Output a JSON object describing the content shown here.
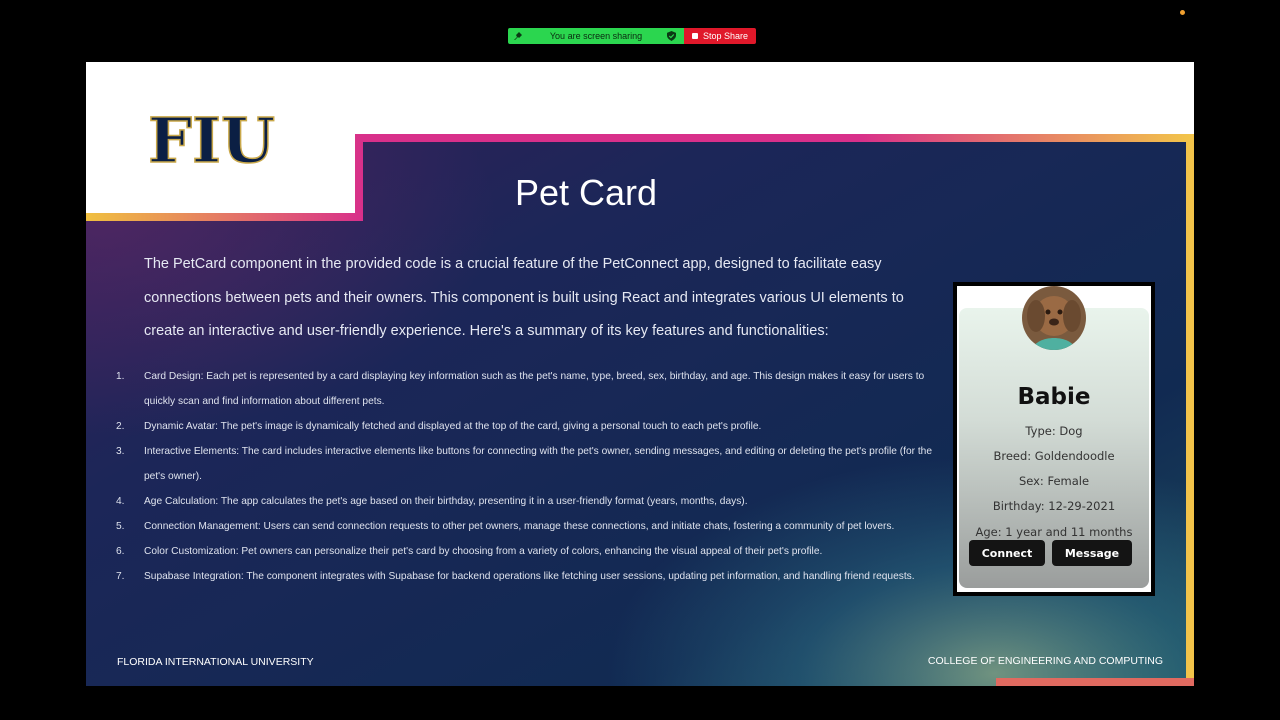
{
  "share_bar": {
    "status_text": "You are screen sharing",
    "stop_label": "Stop Share",
    "status_color": "#2bd64f",
    "stop_color": "#e0182a"
  },
  "slide": {
    "logo_text": "FIU",
    "title": "Pet Card",
    "intro": "The PetCard component in the provided code is a crucial feature of the PetConnect app, designed to facilitate easy connections between pets and their owners. This component is built using React and integrates various UI elements to create an interactive and user-friendly experience. Here's a summary of its key features and functionalities:",
    "features": [
      {
        "num": "1.",
        "text": "Card Design: Each pet is represented by a card displaying key information such as the pet's name, type, breed, sex, birthday, and age. This design makes it easy for users to quickly scan and find information about different pets."
      },
      {
        "num": "2.",
        "text": "Dynamic Avatar: The pet's image is dynamically fetched and displayed at the top of the card, giving a personal touch to each pet's profile."
      },
      {
        "num": "3.",
        "text": "Interactive Elements: The card includes interactive elements like buttons for connecting with the pet's owner, sending messages, and editing or deleting the pet's profile (for the pet's owner)."
      },
      {
        "num": "4.",
        "text": "Age Calculation: The app calculates the pet's age based on their birthday, presenting it in a user-friendly format (years, months, days)."
      },
      {
        "num": "5.",
        "text": "Connection Management: Users can send connection requests to other pet owners, manage these connections, and initiate chats, fostering a community of pet lovers."
      },
      {
        "num": "6.",
        "text": "Color Customization: Pet owners can personalize their pet's card by choosing from a variety of colors, enhancing the visual appeal of their pet's profile."
      },
      {
        "num": "7.",
        "text": "Supabase Integration: The component integrates with Supabase for backend operations like fetching user sessions, updating pet information, and handling friend requests."
      }
    ],
    "footer_left": "FLORIDA INTERNATIONAL UNIVERSITY",
    "footer_right": "COLLEGE OF ENGINEERING AND COMPUTING"
  },
  "pet_card": {
    "name": "Babie",
    "type": "Type: Dog",
    "breed": "Breed: Goldendoodle",
    "sex": "Sex: Female",
    "birthday": "Birthday: 12-29-2021",
    "age": "Age: 1 year and 11 months",
    "connect_label": "Connect",
    "message_label": "Message"
  }
}
